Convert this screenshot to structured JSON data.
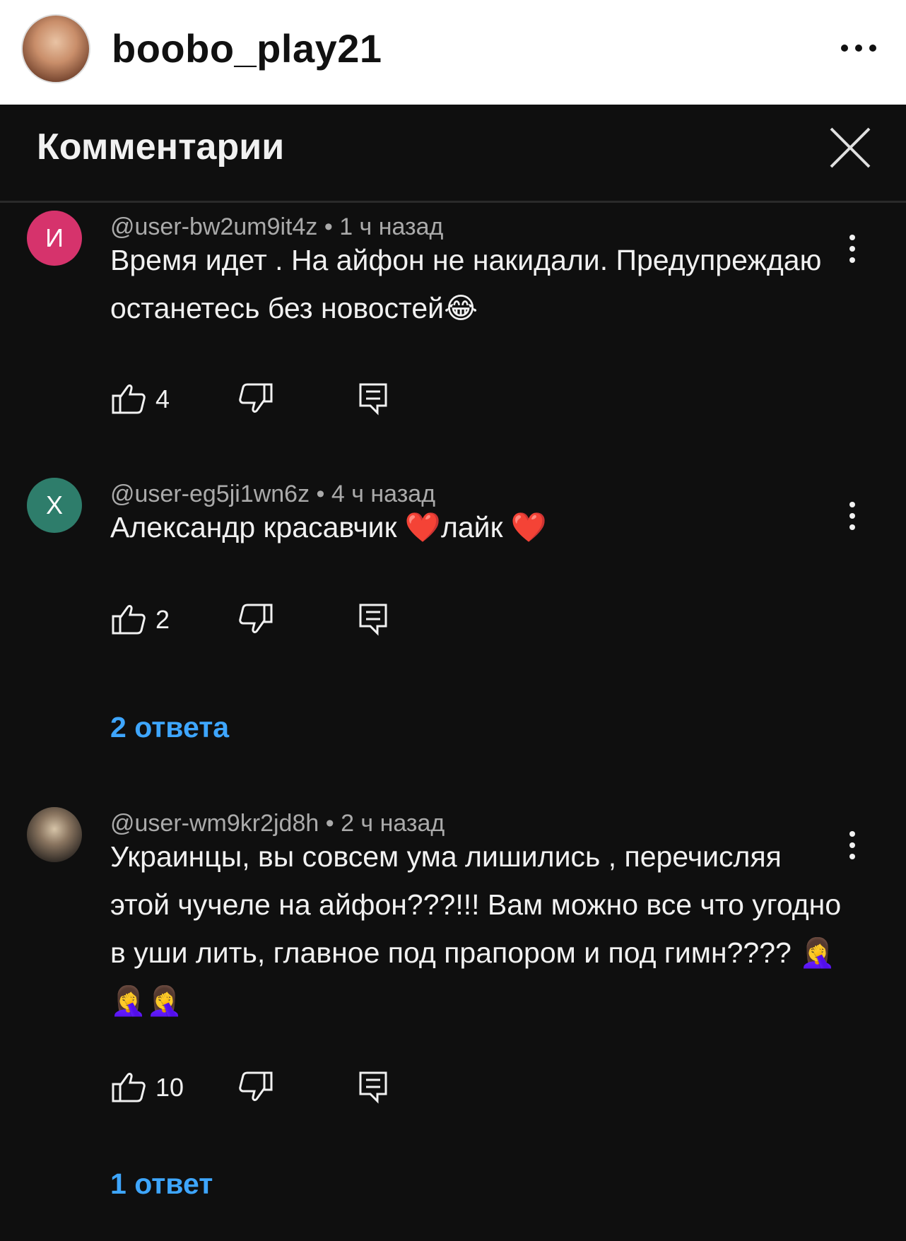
{
  "header": {
    "username": "boobo_play21",
    "avatar_icon": "profile-photo",
    "more_icon": "more-horizontal-icon"
  },
  "panel": {
    "title": "Комментарии",
    "close_icon": "close-icon",
    "background": "#0f0f0f"
  },
  "comments": [
    {
      "avatar_letter": "И",
      "avatar_color": "#d6336c",
      "author": "@user-bw2um9it4z",
      "time": "1 ч назад",
      "text": "Время идет . На айфон не накидали. Предупреждаю останетесь без новостей😂",
      "likes": "4"
    },
    {
      "avatar_letter": "Х",
      "avatar_color": "#2e7d6b",
      "author": "@user-eg5ji1wn6z",
      "time": "4 ч назад",
      "text": "Александр красавчик ❤️лайк ❤️",
      "likes": "2",
      "replies": "2 ответа"
    },
    {
      "avatar_letter": "",
      "avatar_color": "#3a3530",
      "author": "@user-wm9kr2jd8h",
      "time": "2 ч назад",
      "text": "Украинцы, вы совсем ума лишились , перечисляя этой чучеле на айфон???!!! Вам можно все что угодно в уши лить, главное под прапором и под гимн???? 🤦‍♀️🤦‍♀️🤦‍♀️",
      "likes": "10",
      "replies": "1 ответ"
    }
  ],
  "accent_color": "#3ea6ff",
  "separator": " • "
}
